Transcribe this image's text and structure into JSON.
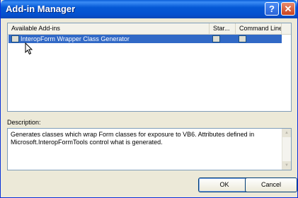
{
  "window": {
    "title": "Add-in Manager",
    "help_glyph": "?",
    "close_glyph": "✕"
  },
  "addins": {
    "columns": [
      "Available Add-ins",
      "Star...",
      "Command Line"
    ],
    "rows": [
      {
        "name": "InteropForm Wrapper Class Generator",
        "selected": true,
        "startup": false,
        "command_line": false
      }
    ]
  },
  "description": {
    "label": "Description:",
    "text": "Generates classes which wrap Form classes for exposure to VB6.  Attributes defined in Microsoft.InteropFormTools control what is generated."
  },
  "buttons": {
    "ok": "OK",
    "cancel": "Cancel"
  },
  "colors": {
    "title_bar": "#0559d6",
    "selection": "#3169c6",
    "dialog": "#ece9d8"
  },
  "icons": [
    "help-icon",
    "close-icon",
    "mouse-cursor-icon",
    "scroll-up-icon",
    "scroll-down-icon"
  ]
}
